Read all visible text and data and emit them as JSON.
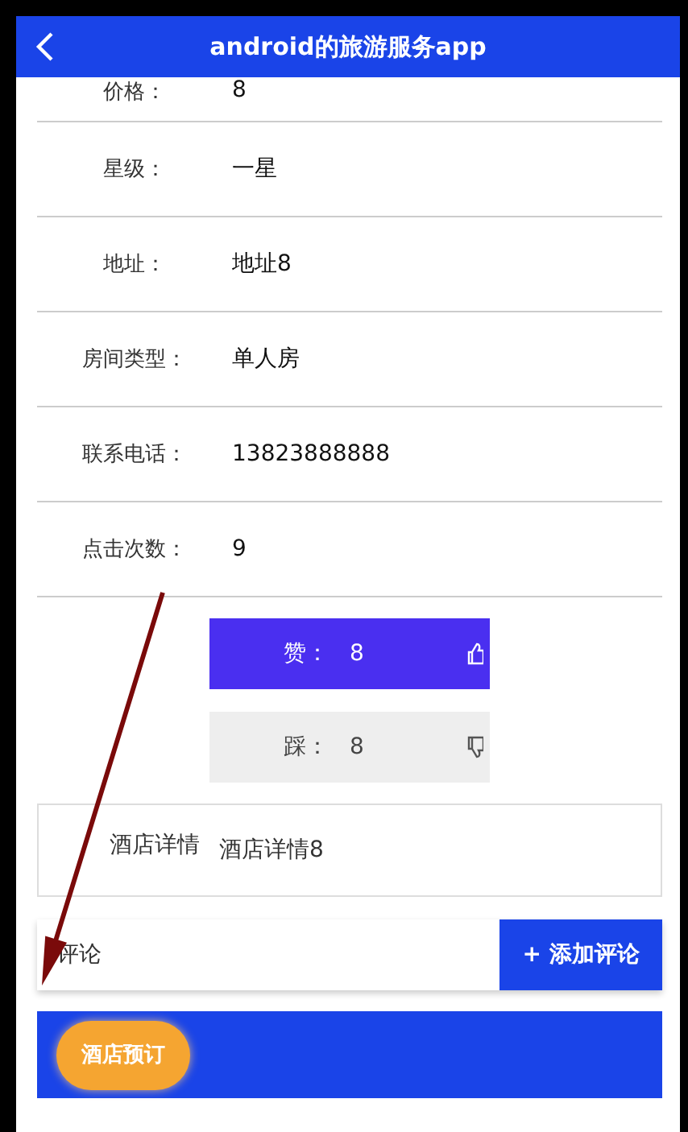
{
  "header": {
    "title": "android的旅游服务app"
  },
  "fields": [
    {
      "label": "价格：",
      "value": "8"
    },
    {
      "label": "星级：",
      "value": "一星"
    },
    {
      "label": "地址：",
      "value": "地址8"
    },
    {
      "label": "房间类型：",
      "value": "单人房"
    },
    {
      "label": "联系电话：",
      "value": "13823888888"
    },
    {
      "label": "点击次数：",
      "value": "9"
    }
  ],
  "votes": [
    {
      "kind": "like",
      "label": "赞：",
      "count": "8"
    },
    {
      "kind": "dislike",
      "label": "踩：",
      "count": "8"
    }
  ],
  "details": {
    "label": "酒店详情",
    "value": "酒店详情8"
  },
  "comment": {
    "placeholder": "评论",
    "button": "+ 添加评论"
  },
  "book_button": "酒店预订"
}
